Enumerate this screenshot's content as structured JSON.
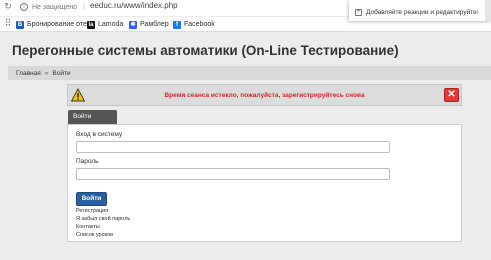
{
  "browser": {
    "security_text": "Не защищено",
    "url": "eeduc.ru/www/index.php",
    "bookmarks": [
      {
        "label": "Бронирование оте...",
        "icon": "booking-icon",
        "color": "#1a5bb5",
        "glyph": "B"
      },
      {
        "label": "Lamoda",
        "icon": "lamoda-icon",
        "color": "#111111",
        "glyph": "la"
      },
      {
        "label": "Рамблер",
        "icon": "rambler-icon",
        "color": "#315efb",
        "glyph": "✱"
      },
      {
        "label": "Facebook",
        "icon": "facebook-icon",
        "color": "#1877f2",
        "glyph": "f"
      }
    ],
    "extension_popup": {
      "label": "Добавляйте реакции и редактируйте",
      "icon": "add-reaction-icon"
    }
  },
  "page": {
    "title": "Перегонные системы автоматики (On-Line Тестирование)",
    "breadcrumb": [
      "Главная",
      "Войти"
    ],
    "error": {
      "message": "Время сеанса истекло, пожалуйста, зарегистрируйтесь снова",
      "color": "#d62828"
    },
    "login": {
      "tab_label": "Войти",
      "username_label": "Вход в систему",
      "username_value": "",
      "password_label": "Пароль",
      "password_value": "",
      "submit_label": "Войти",
      "links": [
        "Регистрация",
        "Я забыл свой пароль",
        "Контакты",
        "Список уроков"
      ]
    }
  },
  "colors": {
    "accent": "#2b5f9f",
    "error": "#d62828",
    "tab": "#555555"
  }
}
